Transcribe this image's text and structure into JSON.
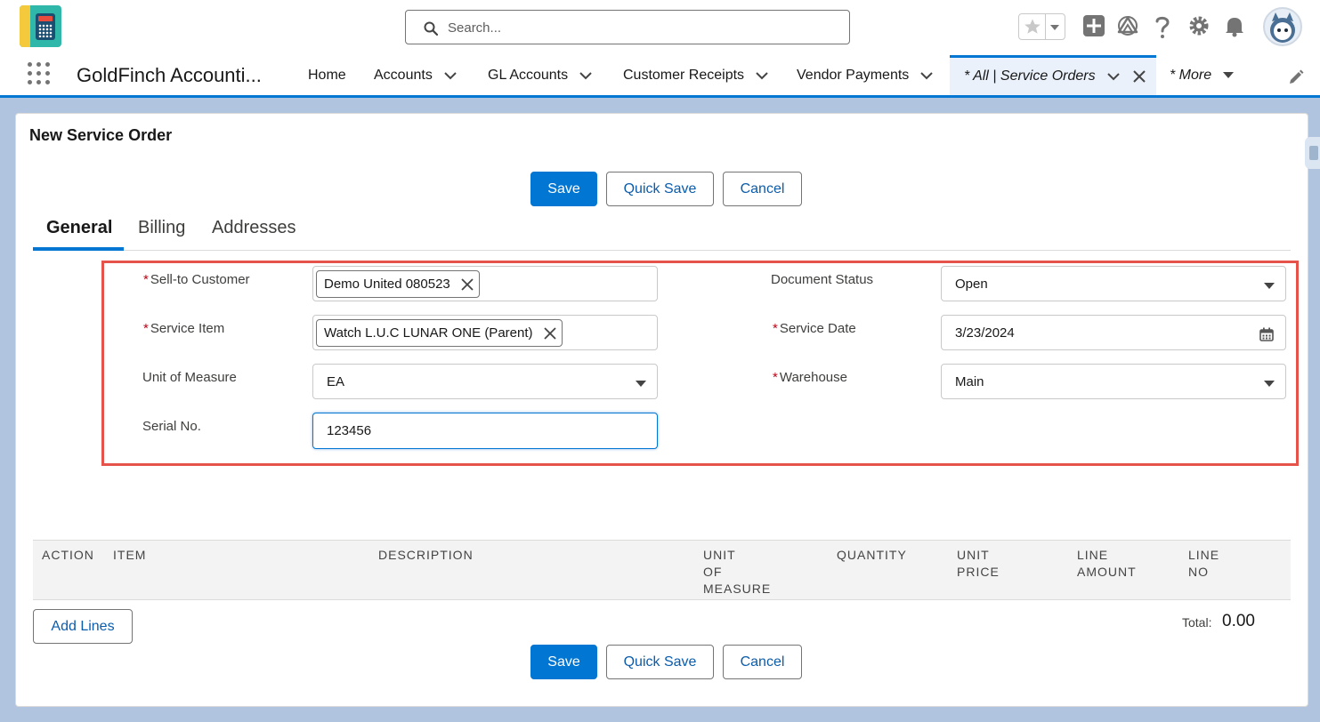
{
  "header": {
    "search_placeholder": "Search..."
  },
  "nav": {
    "app_name": "GoldFinch Accounti...",
    "items": [
      {
        "label": "Home"
      },
      {
        "label": "Accounts"
      },
      {
        "label": "GL Accounts"
      },
      {
        "label": "Customer Receipts"
      },
      {
        "label": "Vendor Payments"
      }
    ],
    "active_tab": "* All | Service Orders",
    "more": "* More"
  },
  "page": {
    "title": "New Service Order"
  },
  "buttons": {
    "save": "Save",
    "quick_save": "Quick Save",
    "cancel": "Cancel",
    "add_lines": "Add Lines"
  },
  "tabs": [
    "General",
    "Billing",
    "Addresses"
  ],
  "form": {
    "sell_to_customer": {
      "label": "Sell-to Customer",
      "required": "*",
      "value": "Demo United 080523"
    },
    "service_item": {
      "label": "Service Item",
      "required": "*",
      "value": "Watch L.U.C LUNAR ONE (Parent)"
    },
    "unit_of_measure": {
      "label": "Unit of Measure",
      "value": "EA"
    },
    "serial_no": {
      "label": "Serial No.",
      "value": "123456"
    },
    "document_status": {
      "label": "Document Status",
      "value": "Open"
    },
    "service_date": {
      "label": "Service Date",
      "required": "*",
      "value": "3/23/2024"
    },
    "warehouse": {
      "label": "Warehouse",
      "required": "*",
      "value": "Main"
    }
  },
  "table": {
    "columns": {
      "action": "ACTION",
      "item": "ITEM",
      "description": "DESCRIPTION",
      "unit_of_measure": [
        "UNIT",
        "OF",
        "MEASURE"
      ],
      "quantity": "QUANTITY",
      "unit_price": [
        "UNIT",
        "PRICE"
      ],
      "line_amount": [
        "LINE",
        "AMOUNT"
      ],
      "line_no": [
        "LINE",
        "NO"
      ]
    }
  },
  "total": {
    "label": "Total:",
    "value": "0.00"
  },
  "colors": {
    "brand": "#0176d3",
    "highlight": "#e5534b",
    "required": "#ba0517"
  }
}
